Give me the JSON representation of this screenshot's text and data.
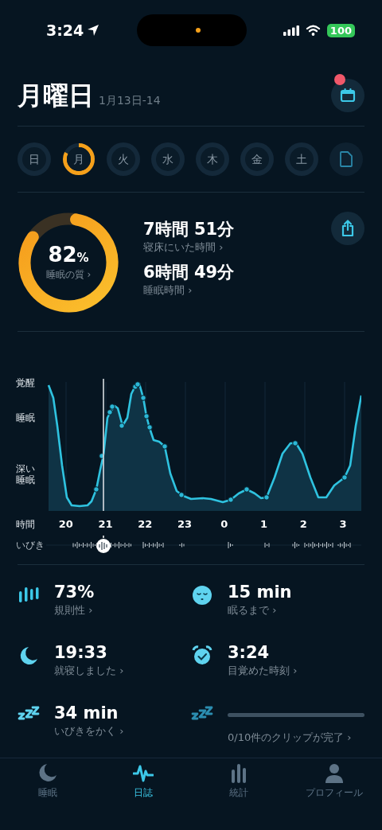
{
  "status_bar": {
    "time": "3:24",
    "battery": "100"
  },
  "header": {
    "title": "月曜日",
    "date": "1月13日-14",
    "notification_dot": true
  },
  "days": [
    {
      "label": "日",
      "selected": false
    },
    {
      "label": "月",
      "selected": true
    },
    {
      "label": "火",
      "selected": false
    },
    {
      "label": "水",
      "selected": false
    },
    {
      "label": "木",
      "selected": false
    },
    {
      "label": "金",
      "selected": false
    },
    {
      "label": "土",
      "selected": false
    }
  ],
  "score": {
    "value": "82",
    "unit": "%",
    "label": "睡眠の質 ›",
    "level": 0.82
  },
  "durations": [
    {
      "value": "7時間 51分",
      "label": "寝床にいた時間 ›"
    },
    {
      "value": "6時間 49分",
      "label": "睡眠時間 ›"
    }
  ],
  "chart": {
    "y_labels": [
      "覚醒",
      "睡眠",
      "深い睡眠"
    ],
    "x_title": "時間",
    "x_labels": [
      "20",
      "21",
      "22",
      "23",
      "0",
      "1",
      "2",
      "3"
    ],
    "snore_label": "いびき"
  },
  "metrics": [
    {
      "kind": "stat",
      "value": "73%",
      "label": "規則性 ›"
    },
    {
      "kind": "stat",
      "value": "15 min",
      "label": "眠るまで ›"
    },
    {
      "kind": "stat",
      "value": "19:33",
      "label": "就寝しました ›"
    },
    {
      "kind": "stat",
      "value": "3:24",
      "label": "目覚めた時刻 ›"
    },
    {
      "kind": "stat",
      "value": "34 min",
      "label": "いびきをかく ›"
    },
    {
      "kind": "progress",
      "level": 0,
      "label": "0/10件のクリップが完了 ›"
    }
  ],
  "tabs": [
    {
      "label": "睡眠",
      "selected": false
    },
    {
      "label": "日誌",
      "selected": true
    },
    {
      "label": "統計",
      "selected": false
    },
    {
      "label": "プロフィール",
      "selected": false
    }
  ]
}
